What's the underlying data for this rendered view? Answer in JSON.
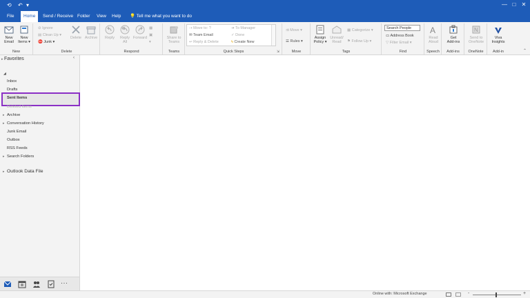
{
  "titlebar": {
    "controls": [
      "—",
      "□",
      "✕"
    ]
  },
  "menu": {
    "tabs": [
      "File",
      "Home",
      "Send / Receive",
      "Folder",
      "View",
      "Help"
    ],
    "active_tab": "Home",
    "tell_me": "Tell me what you want to do"
  },
  "ribbon": {
    "new": {
      "new_email": [
        "New",
        "Email"
      ],
      "new_items": [
        "New",
        "Items ▾"
      ],
      "label": "New"
    },
    "delete": {
      "ignore": "Ignore",
      "clean_up": "Clean Up ▾",
      "junk": "Junk ▾",
      "delete": "Delete",
      "archive": "Archive",
      "label": "Delete"
    },
    "respond": {
      "reply": "Reply",
      "reply_all": [
        "Reply",
        "All"
      ],
      "forward": "Forward",
      "label": "Respond"
    },
    "teams": {
      "share": [
        "Share to",
        "Teams"
      ],
      "label": "Teams"
    },
    "quick_steps": {
      "items": [
        "Move to: ?",
        "Team Email",
        "Reply & Delete",
        "To Manager",
        "Done",
        "Create New"
      ],
      "label": "Quick Steps"
    },
    "move": {
      "move": "Move ▾",
      "rules": "Rules ▾",
      "label": "Move"
    },
    "tags": {
      "assign_policy": [
        "Assign",
        "Policy ▾"
      ],
      "unread_read": [
        "Unread/",
        "Read"
      ],
      "categorize": "Categorize ▾",
      "follow_up": "Follow Up ▾",
      "label": "Tags"
    },
    "find": {
      "search_people": "Search People",
      "address_book": "Address Book",
      "filter_email": "Filter Email ▾",
      "label": "Find"
    },
    "speech": {
      "read_aloud": [
        "Read",
        "Aloud"
      ],
      "label": "Speech"
    },
    "addins": {
      "get_addins": [
        "Get",
        "Add-ins"
      ],
      "label": "Add-ins"
    },
    "onenote": {
      "send": [
        "Send to",
        "OneNote"
      ],
      "label": "OneNote"
    },
    "viva": {
      "insights": [
        "Viva",
        "Insights"
      ],
      "label": "Add-in"
    }
  },
  "folders": {
    "favorites": "Favorites",
    "items": [
      {
        "label": "Inbox"
      },
      {
        "label": "Drafts"
      },
      {
        "label": "Sent Items"
      },
      {
        "label": "Deleted Items"
      },
      {
        "label": "Archive"
      },
      {
        "label": "Conversation History"
      },
      {
        "label": "Junk Email"
      },
      {
        "label": "Outbox"
      },
      {
        "label": "RSS Feeds"
      },
      {
        "label": "Search Folders"
      }
    ],
    "data_file": "Outlook Data File"
  },
  "navbar": {
    "more": "···"
  },
  "status": {
    "connection": "Online with: Microsoft Exchange",
    "zoom_marks": [
      "-",
      "+"
    ]
  },
  "colors": {
    "accent": "#1e5cb8",
    "selection_outline": "#8a2fc5"
  }
}
